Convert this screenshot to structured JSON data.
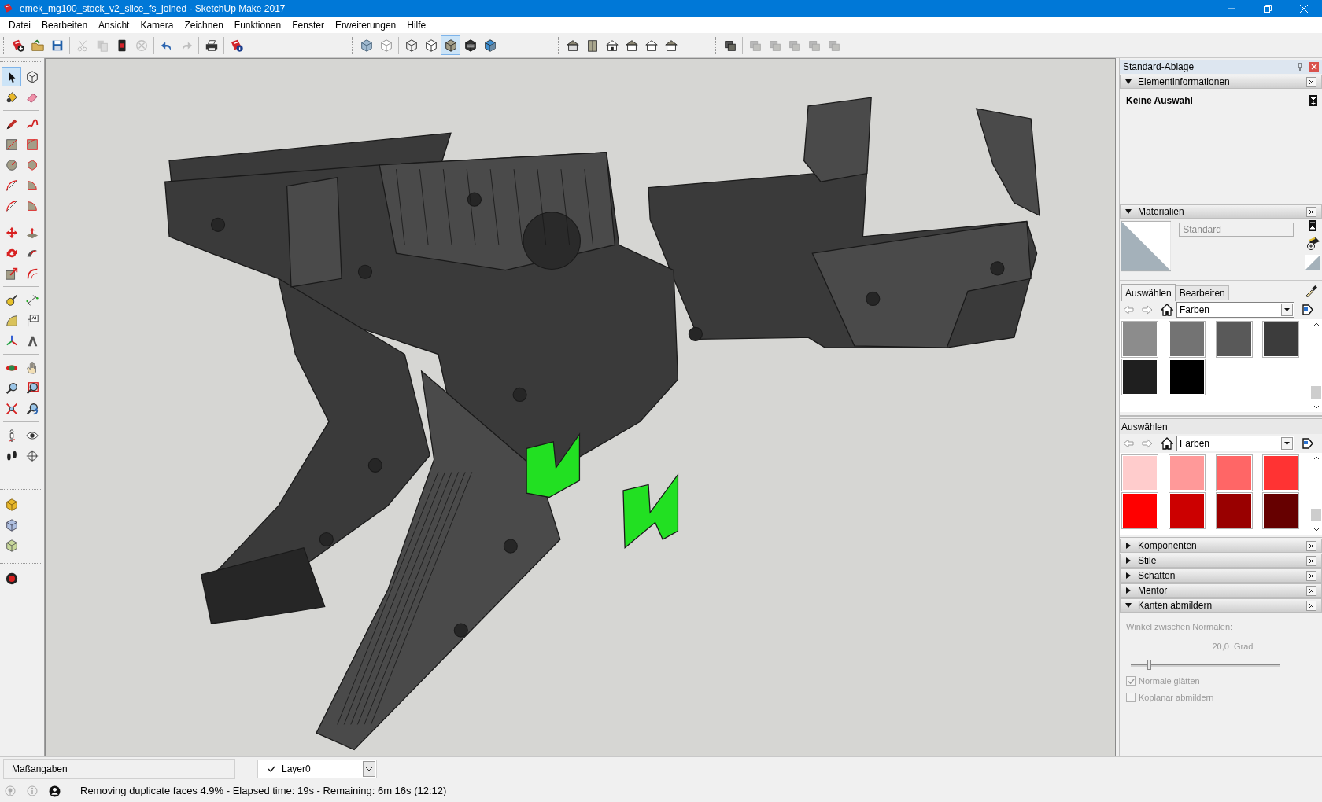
{
  "window": {
    "title": "emek_mg100_stock_v2_slice_fs_joined - SketchUp Make 2017"
  },
  "menu": [
    "Datei",
    "Bearbeiten",
    "Ansicht",
    "Kamera",
    "Zeichnen",
    "Funktionen",
    "Fenster",
    "Erweiterungen",
    "Hilfe"
  ],
  "toolbars": [
    [
      {
        "kind": "logo-plus",
        "disabled": false
      },
      {
        "kind": "folder",
        "disabled": false
      },
      {
        "kind": "floppy",
        "disabled": false
      }
    ],
    [
      {
        "kind": "scissors",
        "disabled": true
      },
      {
        "kind": "pages",
        "disabled": true
      },
      {
        "kind": "clipboard",
        "disabled": false
      },
      {
        "kind": "circle-x",
        "disabled": true
      }
    ],
    [
      {
        "kind": "undo-arrow",
        "disabled": false
      },
      {
        "kind": "redo-arrow",
        "disabled": true
      }
    ],
    [
      {
        "kind": "printer",
        "disabled": false
      }
    ],
    [
      {
        "kind": "logo-info",
        "disabled": false
      }
    ]
  ],
  "style_toolbar": [
    [
      {
        "kind": "translucent-cube",
        "selected": false
      },
      {
        "kind": "dashed-cube",
        "selected": false
      }
    ],
    [
      {
        "kind": "wire-cube",
        "selected": false
      },
      {
        "kind": "plain-cube",
        "selected": false
      },
      {
        "kind": "solid-cube",
        "selected": true
      },
      {
        "kind": "striped-cube",
        "selected": false
      },
      {
        "kind": "two-tone-cube",
        "selected": false
      }
    ]
  ],
  "view_toolbar": [
    {
      "kind": "house-3d",
      "disabled": false
    },
    {
      "kind": "book",
      "disabled": false
    },
    {
      "kind": "house",
      "disabled": false
    },
    {
      "kind": "house-flat",
      "disabled": false
    },
    {
      "kind": "house-outline",
      "disabled": false
    },
    {
      "kind": "house-flat",
      "disabled": false
    }
  ],
  "section_toolbar": [
    [
      {
        "kind": "layers",
        "disabled": false
      }
    ],
    [
      {
        "kind": "layers",
        "disabled": true
      },
      {
        "kind": "layers",
        "disabled": true
      },
      {
        "kind": "layers",
        "disabled": true
      },
      {
        "kind": "layers",
        "disabled": true
      },
      {
        "kind": "layers",
        "disabled": true
      }
    ]
  ],
  "tool_palette": [
    [
      {
        "kind": "arrow",
        "selected": true
      },
      {
        "kind": "wire-cube",
        "selected": false
      },
      {
        "kind": "bucket",
        "selected": false
      },
      {
        "kind": "eraser",
        "selected": false
      }
    ],
    [
      {
        "kind": "pencil",
        "selected": false
      },
      {
        "kind": "squiggle",
        "selected": false
      },
      {
        "kind": "rectangle",
        "selected": false
      },
      {
        "kind": "rotated-rectangle",
        "selected": false
      },
      {
        "kind": "circle",
        "selected": false
      },
      {
        "kind": "polygon",
        "selected": false
      },
      {
        "kind": "arc",
        "selected": false
      },
      {
        "kind": "pie",
        "selected": false
      },
      {
        "kind": "arc",
        "selected": false
      },
      {
        "kind": "pie",
        "selected": false
      }
    ],
    [
      {
        "kind": "move-arrows",
        "selected": false
      },
      {
        "kind": "push-pull",
        "selected": false
      },
      {
        "kind": "rotate-arrows",
        "selected": false
      },
      {
        "kind": "follow-me",
        "selected": false
      },
      {
        "kind": "scale",
        "selected": false
      },
      {
        "kind": "offset",
        "selected": false
      }
    ],
    [
      {
        "kind": "tape-measure",
        "selected": false
      },
      {
        "kind": "dimension",
        "selected": false
      },
      {
        "kind": "protractor",
        "selected": false
      },
      {
        "kind": "text-label",
        "selected": false
      },
      {
        "kind": "axes",
        "selected": false
      },
      {
        "kind": "letter-block",
        "selected": false
      }
    ],
    [
      {
        "kind": "orbit",
        "selected": false
      },
      {
        "kind": "hand",
        "selected": false
      },
      {
        "kind": "magnifier",
        "selected": false
      },
      {
        "kind": "zoom-window",
        "selected": false
      },
      {
        "kind": "zoom-extents",
        "selected": false
      },
      {
        "kind": "zoom-previous",
        "selected": false
      }
    ],
    [
      {
        "kind": "figure",
        "selected": false
      },
      {
        "kind": "eye",
        "selected": false
      },
      {
        "kind": "footprints",
        "selected": false
      },
      {
        "kind": "section-plane",
        "selected": false
      }
    ]
  ],
  "warehouse_toolbar": [
    {
      "kind": "warehouse-cube"
    },
    {
      "kind": "extension-cube"
    },
    {
      "kind": "share-cube"
    }
  ],
  "extra_toolbar": [
    {
      "kind": "globe"
    }
  ],
  "tray": {
    "title": "Standard-Ablage",
    "entity_info": {
      "title": "Elementinformationen",
      "expanded": true,
      "selection": "Keine Auswahl"
    },
    "materials": {
      "title": "Materialien",
      "expanded": true,
      "name": "Standard",
      "tabs": [
        {
          "label": "Auswählen",
          "selected": true
        },
        {
          "label": "Bearbeiten",
          "selected": false
        }
      ],
      "library": "Farben",
      "swatches": [
        {
          "color": "#8c8c8c"
        },
        {
          "color": "#737373"
        },
        {
          "color": "#595959"
        },
        {
          "color": "#3c3c3c"
        },
        {
          "color": "#1f1f1f"
        },
        {
          "color": "#000000"
        }
      ],
      "secondary": {
        "title": "Auswählen",
        "library": "Farben",
        "swatches": [
          {
            "color": "#ffcccc"
          },
          {
            "color": "#ff9999"
          },
          {
            "color": "#ff6666"
          },
          {
            "color": "#ff3333"
          },
          {
            "color": "#ff0000"
          },
          {
            "color": "#cc0000"
          },
          {
            "color": "#990000"
          },
          {
            "color": "#660000"
          }
        ]
      }
    },
    "panels": [
      {
        "title": "Komponenten",
        "expanded": false
      },
      {
        "title": "Stile",
        "expanded": false
      },
      {
        "title": "Schatten",
        "expanded": false
      },
      {
        "title": "Mentor",
        "expanded": false
      },
      {
        "title": "Kanten abmildern",
        "expanded": true
      }
    ],
    "soften": {
      "label": "Winkel zwischen Normalen:",
      "reading": "20,0  Grad",
      "level": 0.12,
      "options": [
        {
          "label": "Normale glätten",
          "checked": true
        },
        {
          "label": "Koplanar abmildern",
          "checked": false
        }
      ]
    }
  },
  "measurements": {
    "label": "Maßangaben"
  },
  "layer": {
    "value": "Layer0"
  },
  "status": "Removing duplicate faces 4.9% - Elapsed time: 19s - Remaining: 6m 16s (12:12)"
}
